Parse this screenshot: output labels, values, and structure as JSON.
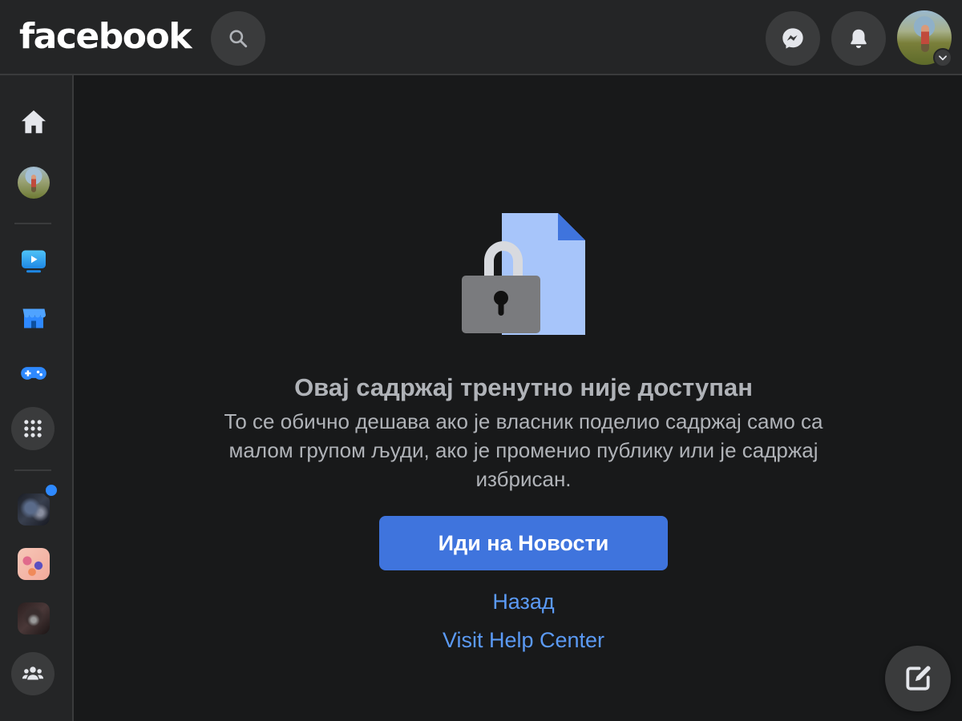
{
  "header": {
    "logo_text": "facebook",
    "icons": {
      "search": "search-icon",
      "messenger": "messenger-icon",
      "notifications": "bell-icon",
      "account_menu": "chevron-down-icon"
    }
  },
  "sidebar": {
    "items": [
      {
        "name": "home",
        "icon": "home-icon"
      },
      {
        "name": "profile",
        "icon": "avatar"
      },
      {
        "name": "watch",
        "icon": "watch-icon"
      },
      {
        "name": "marketplace",
        "icon": "marketplace-icon"
      },
      {
        "name": "gaming",
        "icon": "gaming-icon"
      },
      {
        "name": "menu",
        "icon": "grid-menu-icon"
      },
      {
        "name": "group-1",
        "icon": "group-avatar",
        "has_notification": true
      },
      {
        "name": "group-2",
        "icon": "group-avatar"
      },
      {
        "name": "group-3",
        "icon": "group-avatar"
      },
      {
        "name": "groups",
        "icon": "groups-icon"
      }
    ]
  },
  "main": {
    "headline": "Овај садржај тренутно није доступан",
    "description": "То се обично дешава ако је власник поделио садржај само са малом групом људи, ако је променио публику или је садржај избрисан.",
    "primary_button": "Иди на Новости",
    "back_link": "Назад",
    "help_link": "Visit Help Center"
  },
  "colors": {
    "background": "#18191a",
    "surface": "#242526",
    "secondary_surface": "#3a3b3c",
    "primary_blue": "#3f74dd",
    "link_blue": "#5b9af5",
    "text_secondary": "#b0b3b8"
  }
}
